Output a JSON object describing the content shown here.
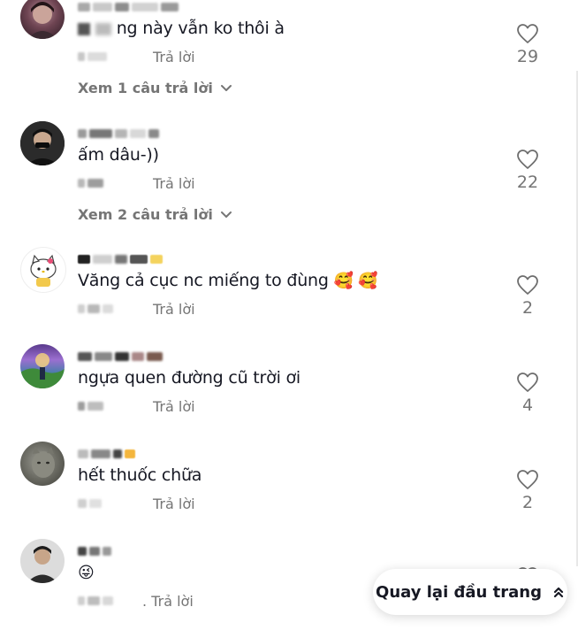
{
  "reply_label": "Trả lời",
  "back_to_top_label": "Quay lại đầu trang",
  "comments": [
    {
      "text": "ng này vẫn ko thôi à",
      "likes": "29",
      "view_replies": "Xem 1 câu trả lời"
    },
    {
      "text": "ấm dâu-))",
      "likes": "22",
      "view_replies": "Xem 2 câu trả lời"
    },
    {
      "text": "Văng cả cục nc miếng to đùng",
      "emoji": "🥰 🥰",
      "likes": "2"
    },
    {
      "text": "ngựa quen đường cũ trời ơi",
      "likes": "4"
    },
    {
      "text": "hết thuốc chữa",
      "likes": "2"
    },
    {
      "text": "😜",
      "reply_prefix": "."
    }
  ],
  "colors": {
    "text_primary": "#161823",
    "text_secondary": "#757575",
    "background": "#ffffff"
  }
}
